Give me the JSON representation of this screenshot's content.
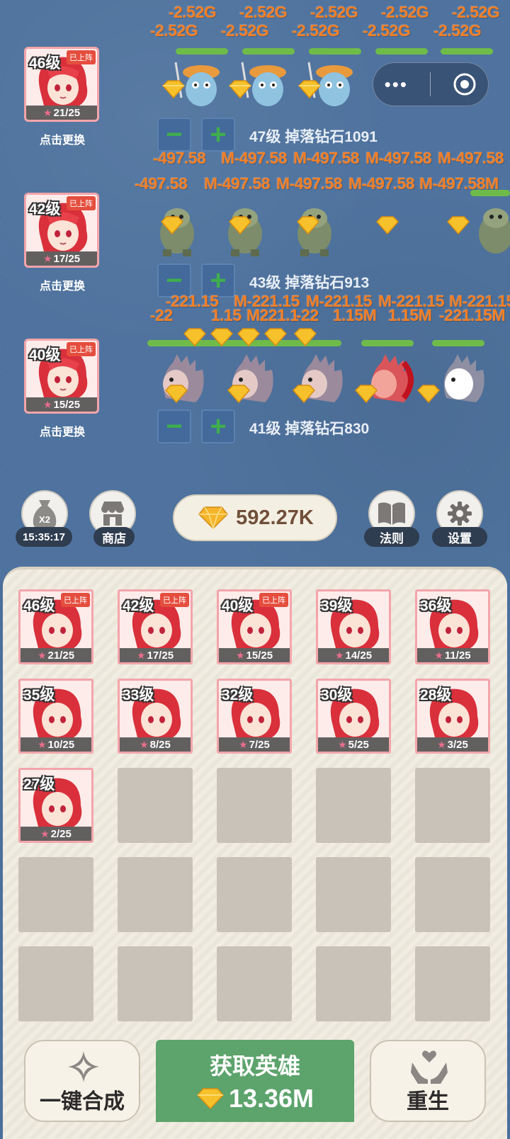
{
  "lanes": [
    {
      "hero": {
        "level": "46级",
        "badge": "已上阵",
        "stars": "21/25"
      },
      "swap": "点击更换",
      "drop": "47级 掉落钻石1091",
      "damage_row1": [
        "-2.52G",
        "-2.52G",
        "-2.52G",
        "-2.52G",
        "-2.52G"
      ],
      "damage_row2": [
        "-2.52G",
        "-2.52G",
        "-2.52G",
        "-2.52G",
        "-2.52G"
      ]
    },
    {
      "hero": {
        "level": "42级",
        "badge": "已上阵",
        "stars": "17/25"
      },
      "swap": "点击更换",
      "drop": "43级 掉落钻石913",
      "damage_row1": [
        "-497.58",
        "M-497.58",
        "M-497.58",
        "M-497.58",
        "M-497.58"
      ],
      "damage_row2": [
        "-497.58",
        "M-497.58",
        "M-497.58",
        "M-497.58",
        "M-497.58M"
      ]
    },
    {
      "hero": {
        "level": "40级",
        "badge": "已上阵",
        "stars": "15/25"
      },
      "swap": "点击更换",
      "drop": "41级 掉落钻石830",
      "damage_row1": [
        "-221.15",
        "M-221.15",
        "M-221.15",
        "M-221.15",
        "M-221.15"
      ],
      "damage_row2": [
        "-22",
        "1.15",
        "M221.1",
        "-22",
        "1.15M",
        "1.15M",
        "-221.15M"
      ]
    }
  ],
  "toolbar": {
    "x2_label": "X2",
    "timer": "15:35:17",
    "shop": "商店",
    "diamonds": "592.27K",
    "rules": "法则",
    "settings": "设置"
  },
  "inventory": [
    {
      "level": "46级",
      "badge": "已上阵",
      "stars": "21/25"
    },
    {
      "level": "42级",
      "badge": "已上阵",
      "stars": "17/25"
    },
    {
      "level": "40级",
      "badge": "已上阵",
      "stars": "15/25"
    },
    {
      "level": "39级",
      "badge": "",
      "stars": "14/25"
    },
    {
      "level": "36级",
      "badge": "",
      "stars": "11/25"
    },
    {
      "level": "35级",
      "badge": "",
      "stars": "10/25"
    },
    {
      "level": "33级",
      "badge": "",
      "stars": "8/25"
    },
    {
      "level": "32级",
      "badge": "",
      "stars": "7/25"
    },
    {
      "level": "30级",
      "badge": "",
      "stars": "5/25"
    },
    {
      "level": "28级",
      "badge": "",
      "stars": "3/25"
    },
    {
      "level": "27级",
      "badge": "",
      "stars": "2/25"
    }
  ],
  "bottom": {
    "merge": "一键合成",
    "recruit_title": "获取英雄",
    "recruit_cost": "13.36M",
    "rebirth": "重生"
  },
  "colors": {
    "field": "#4f739e",
    "damage": "#f57f24",
    "hp": "#6fbb4a",
    "accent_green": "#5ca36c",
    "card_border": "#f3a5aa"
  }
}
